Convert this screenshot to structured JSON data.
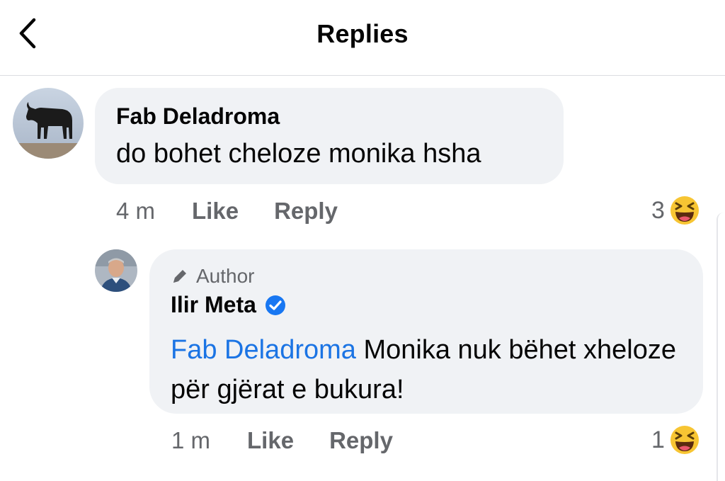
{
  "header": {
    "title": "Replies",
    "back_icon": "chevron-left-icon"
  },
  "comments": [
    {
      "author": "Fab Deladroma",
      "body": "do bohet cheloze monika hsha",
      "time": "4 m",
      "like_label": "Like",
      "reply_label": "Reply",
      "reaction_count": "3",
      "reaction_icon": "haha-emoji-icon"
    },
    {
      "author_tag": "Author",
      "author": "Ilir Meta",
      "verified_icon": "verified-badge-icon",
      "mention": "Fab Deladroma",
      "body": "Monika nuk bëhet xheloze për gjërat e bukura!",
      "time": "1 m",
      "like_label": "Like",
      "reply_label": "Reply",
      "reaction_count": "1",
      "reaction_icon": "haha-emoji-icon"
    }
  ],
  "colors": {
    "mention": "#1b74e4",
    "bubble": "#f0f2f5",
    "meta": "#65676b",
    "verified": "#1877f2"
  }
}
